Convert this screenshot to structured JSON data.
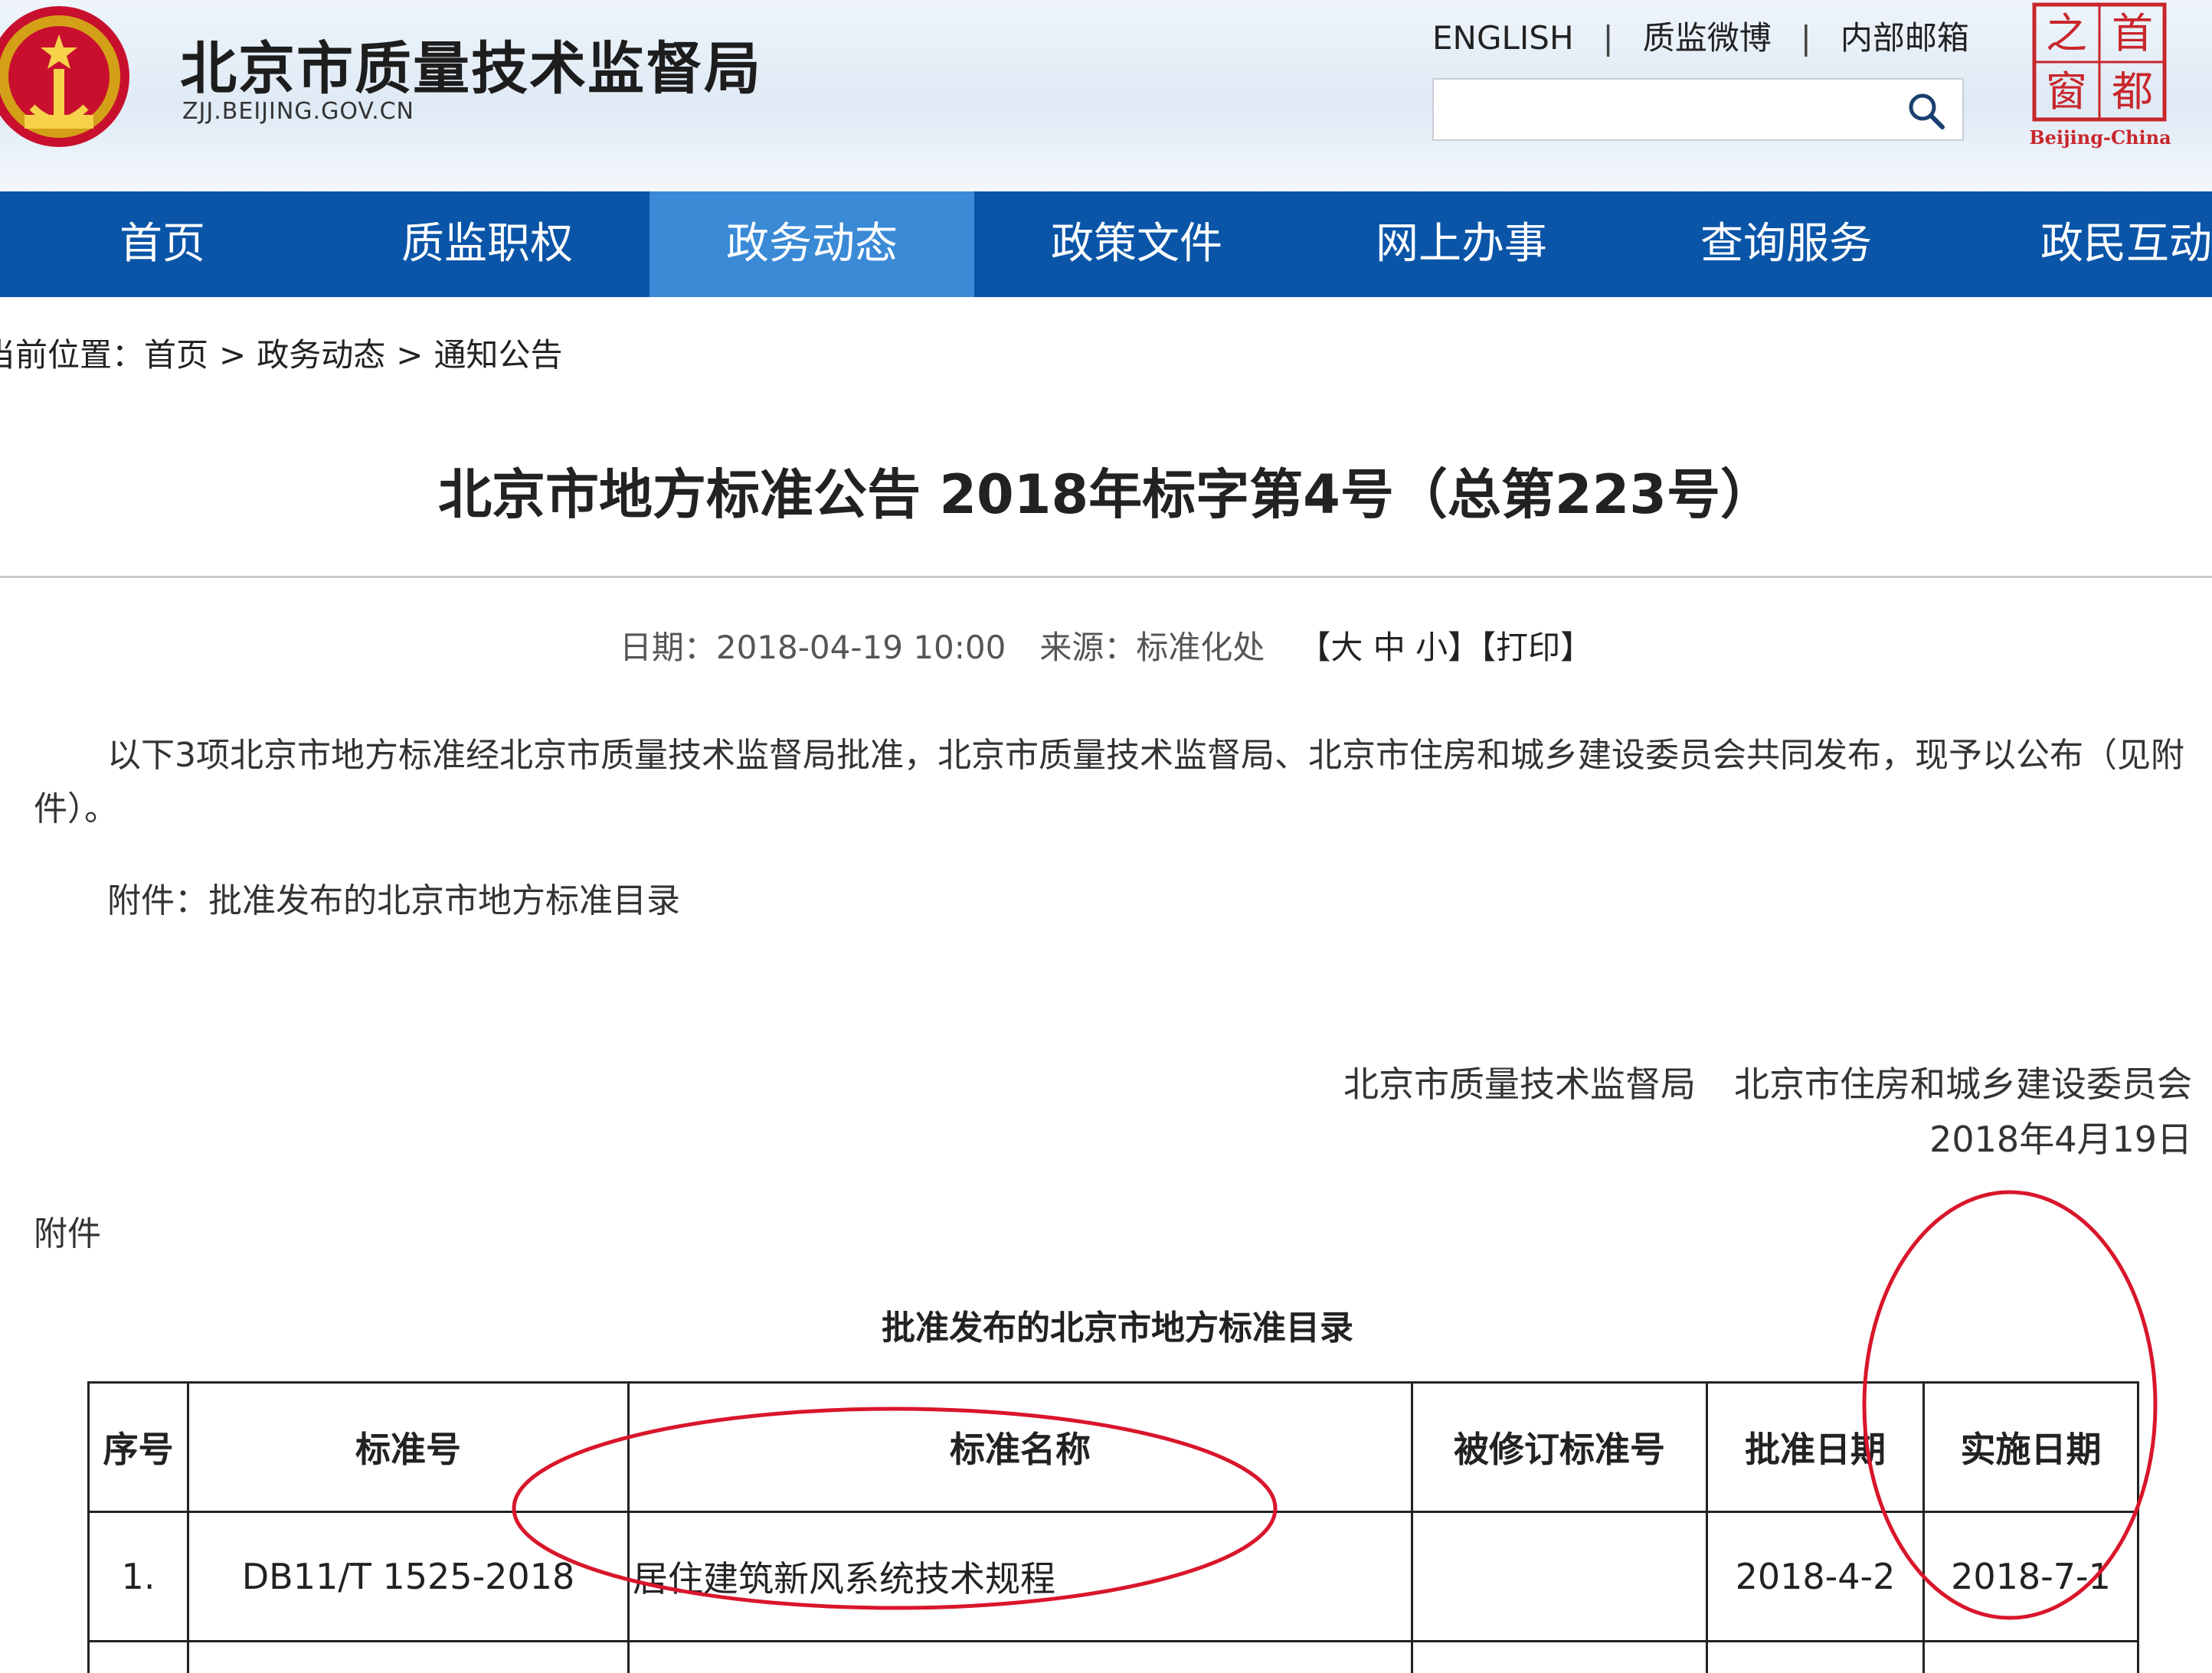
{
  "header": {
    "site_title": "北京市质量技术监督局",
    "site_domain": "ZJJ.BEIJING.GOV.CN",
    "links": [
      "ENGLISH",
      "质监微博",
      "内部邮箱"
    ],
    "separator": "|",
    "search_value": "",
    "badge_chars": [
      "首",
      "都",
      "之",
      "窗"
    ],
    "badge_caption": "Beijing-China"
  },
  "nav": {
    "items": [
      "首页",
      "质监职权",
      "政务动态",
      "政策文件",
      "网上办事",
      "查询服务",
      "政民互动"
    ],
    "active": "政务动态"
  },
  "breadcrumb": {
    "prefix": "当前位置：",
    "items": [
      "首页",
      "政务动态",
      "通知公告"
    ],
    "separator": ">"
  },
  "article": {
    "title": "北京市地方标准公告 2018年标字第4号（总第223号）",
    "date": "日期：2018-04-19 10:00",
    "source": "来源：标准化处",
    "size_controls": "【大 中 小】",
    "print": "【打印】",
    "paragraph": "以下3项北京市地方标准经北京市质量技术监督局批准，北京市质量技术监督局、北京市住房和城乡建设委员会共同发布，现予以公布（见附件）。",
    "attachment_line": "附件：批准发布的北京市地方标准目录",
    "signer_1": "北京市质量技术监督局",
    "signer_2": "北京市住房和城乡建设委员会",
    "sign_date": "2018年4月19日",
    "attachment_label": "附件",
    "table_title": "批准发布的北京市地方标准目录"
  },
  "table": {
    "headers": [
      "序号",
      "标准号",
      "标准名称",
      "被修订标准号",
      "批准日期",
      "实施日期"
    ],
    "rows": [
      [
        "1.",
        "DB11/T 1525-2018",
        "居住建筑新风系统技术规程",
        "",
        "2018-4-2",
        "2018-7-1"
      ]
    ]
  },
  "colors": {
    "nav_bg": "#0a55a8",
    "nav_active_bg": "#3a8ad6",
    "annotation": "#d9162b",
    "badge": "#c8262c"
  }
}
